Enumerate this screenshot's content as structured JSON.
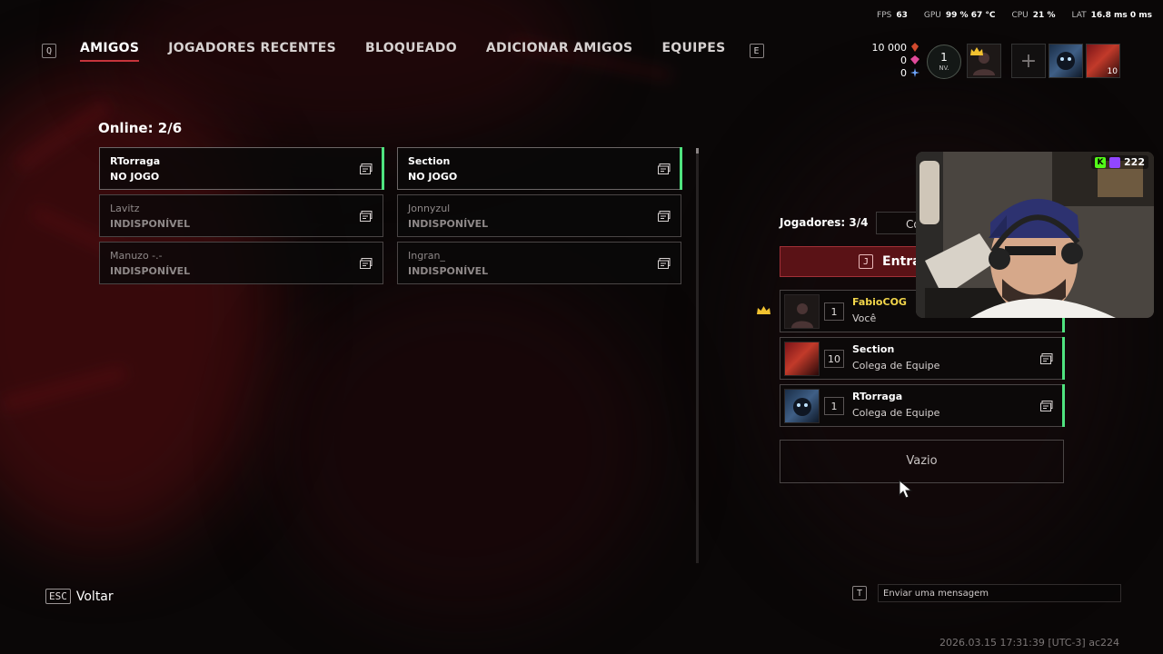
{
  "hud": {
    "fps_label": "FPS",
    "fps_value": "63",
    "gpu_label": "GPU",
    "gpu_value": "99 % 67 °C",
    "cpu_label": "CPU",
    "cpu_value": "21 %",
    "lat_label": "LAT",
    "lat_value": "16.8 ms 0 ms"
  },
  "nav": {
    "left_key": "Q",
    "right_key": "E",
    "tabs": [
      {
        "label": "AMIGOS",
        "active": true
      },
      {
        "label": "JOGADORES RECENTES",
        "active": false
      },
      {
        "label": "BLOQUEADO",
        "active": false
      },
      {
        "label": "ADICIONAR AMIGOS",
        "active": false
      },
      {
        "label": "EQUIPES",
        "active": false
      }
    ]
  },
  "top_right": {
    "currency": [
      "10 000",
      "0",
      "0"
    ],
    "level_value": "1",
    "level_label": "NV.",
    "slot_level": "10"
  },
  "friends": {
    "online_label": "Online: 2/6",
    "list": [
      {
        "name": "RTorraga",
        "status": "NO JOGO",
        "online": true
      },
      {
        "name": "Section",
        "status": "NO JOGO",
        "online": true
      },
      {
        "name": "Lavitz",
        "status": "INDISPONÍVEL",
        "online": false
      },
      {
        "name": "Jonnyzul",
        "status": "INDISPONÍVEL",
        "online": false
      },
      {
        "name": "Manuzo -.-",
        "status": "INDISPONÍVEL",
        "online": false
      },
      {
        "name": "Ingran_",
        "status": "INDISPONÍVEL",
        "online": false
      }
    ]
  },
  "party": {
    "players_label": "Jogadores: 3/4",
    "copy_label": "Co",
    "join_key": "J",
    "join_label": "Entrar",
    "members": [
      {
        "level": "1",
        "name": "FabioCOG",
        "role": "Você",
        "is_me": true
      },
      {
        "level": "10",
        "name": "Section",
        "role": "Colega de Equipe",
        "is_me": false
      },
      {
        "level": "1",
        "name": "RTorraga",
        "role": "Colega de Equipe",
        "is_me": false
      }
    ],
    "empty_label": "Vazio"
  },
  "footer": {
    "back_key": "ESC",
    "back_label": "Voltar",
    "chat_key": "T",
    "chat_placeholder": "Enviar uma mensagem",
    "timestamp": "2026.03.15 17:31:39 [UTC-3] ac224"
  },
  "webcam": {
    "viewer_count": "222"
  },
  "colors": {
    "accent_red": "#c7343b",
    "online_green": "#4fe37f",
    "me_gold": "#f2d64b"
  }
}
